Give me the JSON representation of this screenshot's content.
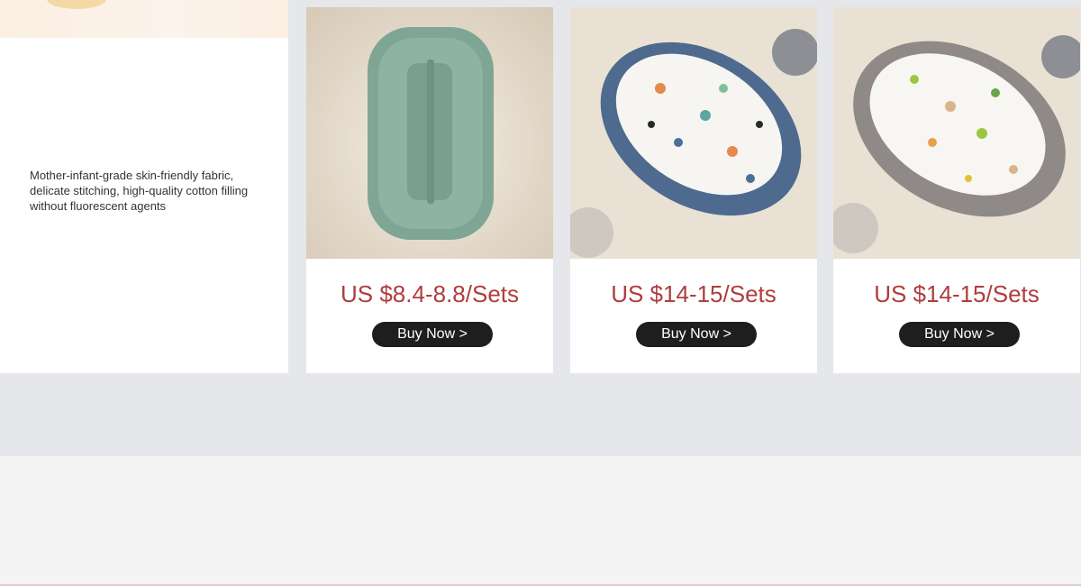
{
  "intro": {
    "description": "Mother-infant-grade skin-friendly fabric, delicate stitching, high-quality cotton filling without fluorescent agents"
  },
  "products": [
    {
      "price": "US $8.4-8.8/Sets",
      "button_label": "Buy Now >",
      "image_name": "green-baby-lounger-photo"
    },
    {
      "price": "US $14-15/Sets",
      "button_label": "Buy Now >",
      "image_name": "blue-sea-animal-print-baby-nest-photo"
    },
    {
      "price": "US $14-15/Sets",
      "button_label": "Buy Now >",
      "image_name": "grey-forest-print-baby-nest-photo"
    }
  ],
  "colors": {
    "price": "#b03d3d",
    "button_bg": "#1e1e1e",
    "button_text": "#ffffff",
    "section_bg": "#e6e7ea",
    "footer_bg": "#f4f4f4"
  }
}
